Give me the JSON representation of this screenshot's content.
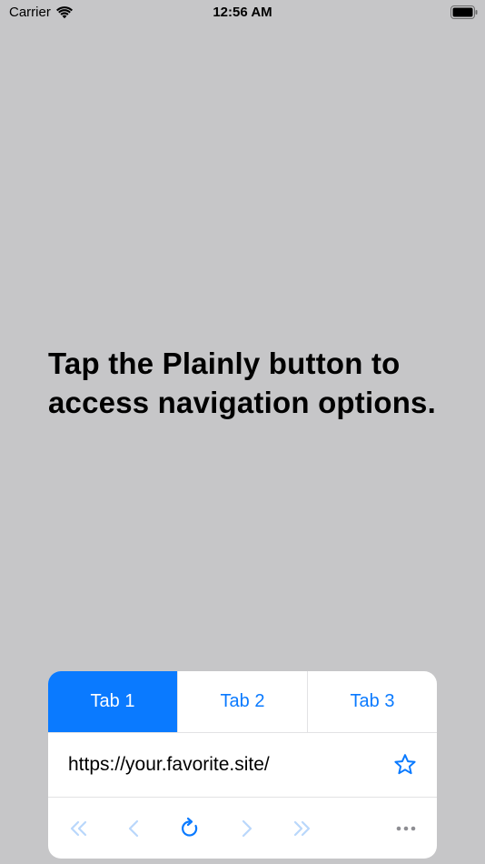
{
  "status_bar": {
    "carrier": "Carrier",
    "time": "12:56 AM",
    "wifi_icon": "wifi-icon",
    "battery_icon": "battery-icon"
  },
  "main": {
    "instruction_text": "Tap the Plainly button to access navigation options."
  },
  "panel": {
    "tabs": [
      {
        "label": "Tab 1",
        "active": true
      },
      {
        "label": "Tab 2",
        "active": false
      },
      {
        "label": "Tab 3",
        "active": false
      }
    ],
    "url": "https://your.favorite.site/",
    "favorite_icon": "star-outline-icon",
    "toolbar": {
      "buttons": [
        {
          "icon": "double-chevron-left-icon",
          "enabled": false
        },
        {
          "icon": "chevron-left-icon",
          "enabled": false
        },
        {
          "icon": "reload-icon",
          "enabled": true
        },
        {
          "icon": "chevron-right-icon",
          "enabled": false
        },
        {
          "icon": "double-chevron-right-icon",
          "enabled": false
        },
        {
          "icon": "more-icon",
          "enabled": true
        }
      ]
    }
  },
  "colors": {
    "accent": "#0a7aff",
    "background": "#c6c6c8",
    "panel": "#ffffff",
    "disabled_icon": "#b9d7fb",
    "more_icon": "#8e8e93"
  }
}
